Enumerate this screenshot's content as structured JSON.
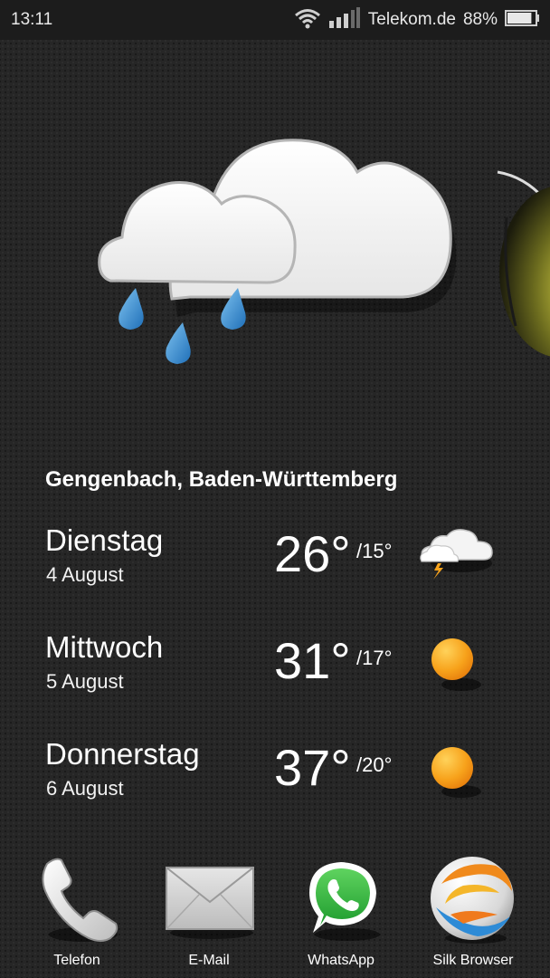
{
  "status_bar": {
    "time": "13:11",
    "carrier": "Telekom.de",
    "battery_percent": "88%",
    "battery_level": 0.88,
    "icons": [
      "wifi-icon",
      "signal-icon",
      "battery-icon"
    ]
  },
  "hero_icon": "cloud-rain-icon",
  "weather": {
    "location": "Gengenbach, Baden-Württemberg",
    "forecast": [
      {
        "day": "Dienstag",
        "date": "4 August",
        "high": "26°",
        "low": "/15°",
        "icon": "cloud-thunder-icon"
      },
      {
        "day": "Mittwoch",
        "date": "5 August",
        "high": "31°",
        "low": "/17°",
        "icon": "sun-icon"
      },
      {
        "day": "Donnerstag",
        "date": "6 August",
        "high": "37°",
        "low": "/20°",
        "icon": "sun-icon"
      }
    ]
  },
  "dock": {
    "apps": [
      {
        "label": "Telefon",
        "icon": "phone-icon"
      },
      {
        "label": "E-Mail",
        "icon": "email-icon"
      },
      {
        "label": "WhatsApp",
        "icon": "whatsapp-icon"
      },
      {
        "label": "Silk Browser",
        "icon": "silk-browser-icon"
      }
    ]
  },
  "colors": {
    "background": "#262626",
    "status_bar": "#1c1c1c",
    "sun": "#f7a21b",
    "rain": "#2f8fd6",
    "whatsapp": "#25b43a"
  }
}
